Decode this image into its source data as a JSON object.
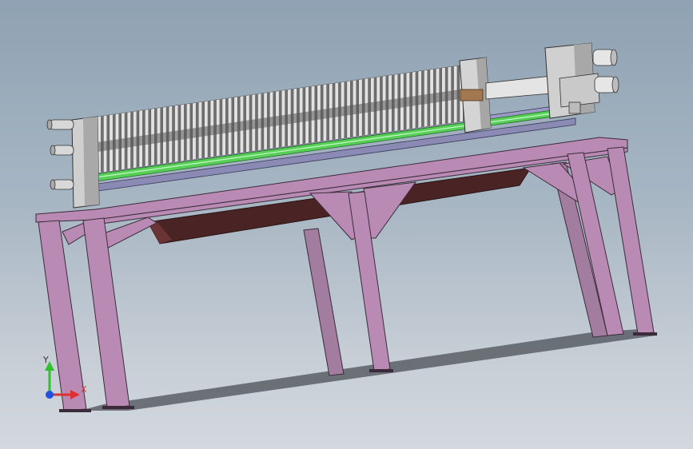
{
  "viewport": {
    "colors": {
      "frame_fill": "#b98bb4",
      "frame_stroke": "#3b2b3a",
      "tray_fill": "#4a2424",
      "plate_light": "#e2e2e2",
      "plate_dark": "#6f6f6f",
      "rail_fill": "#9a9ac4",
      "rod_fill": "#58d058",
      "head_fill": "#cfcfcf",
      "shadow": "#5a5f66"
    },
    "triad": {
      "x_label": "X",
      "y_label": "Y",
      "x_color": "#e03030",
      "y_color": "#30c030",
      "z_color": "#2050e0"
    }
  }
}
